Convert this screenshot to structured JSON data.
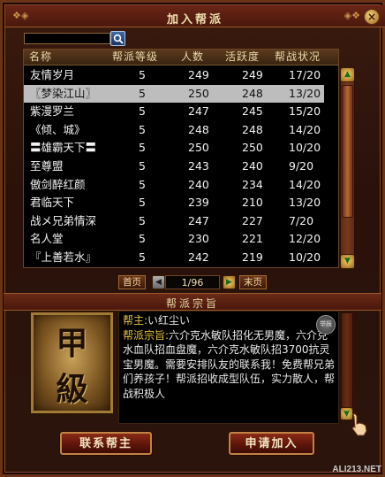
{
  "window": {
    "title": "加入帮派"
  },
  "search": {
    "value": "",
    "button_icon": "search-icon"
  },
  "guild_list": {
    "columns": [
      "名称",
      "帮派等级",
      "人数",
      "活跃度",
      "帮战状况"
    ],
    "selected_index": 1,
    "rows": [
      {
        "name": "友情岁月",
        "level": "5",
        "members": "249",
        "activity": "249",
        "status": "17/20"
      },
      {
        "name": "〖梦染江山〗",
        "level": "5",
        "members": "250",
        "activity": "248",
        "status": "13/20"
      },
      {
        "name": "紫漫罗兰",
        "level": "5",
        "members": "247",
        "activity": "245",
        "status": "15/20"
      },
      {
        "name": "《倾、城》",
        "level": "5",
        "members": "248",
        "activity": "248",
        "status": "14/20"
      },
      {
        "name": "〓雄霸天下〓",
        "level": "5",
        "members": "250",
        "activity": "250",
        "status": "10/20"
      },
      {
        "name": "至尊盟",
        "level": "5",
        "members": "243",
        "activity": "240",
        "status": "9/20"
      },
      {
        "name": "傲剑醉红颜",
        "level": "5",
        "members": "240",
        "activity": "234",
        "status": "14/20"
      },
      {
        "name": "君临天下",
        "level": "5",
        "members": "239",
        "activity": "210",
        "status": "13/20"
      },
      {
        "name": "战メ兄弟情深",
        "level": "5",
        "members": "247",
        "activity": "227",
        "status": "7/20"
      },
      {
        "name": "名人堂",
        "level": "5",
        "members": "230",
        "activity": "221",
        "status": "12/20"
      },
      {
        "name": "『上善若水』",
        "level": "5",
        "members": "242",
        "activity": "219",
        "status": "10/20"
      }
    ]
  },
  "pager": {
    "first_label": "首页",
    "page": "1/96",
    "last_label": "末页"
  },
  "purpose_section": {
    "title": "帮派宗旨",
    "emblem_chars": [
      "甲",
      "級"
    ],
    "leader_label": "帮主:",
    "leader_name": "い红尘い",
    "purpose_label": "帮派宗旨:",
    "purpose_text": "六介克水敏队招化无男魔，六介克水血队招血盘魔，六介克水敏队招3700抗灵宝男魔。需要安排队友的联系我！免费帮兄弟们养孩子！帮派招收成型队伍，实力散人，帮战积极人",
    "seal_text": "举报"
  },
  "buttons": {
    "contact_leader": "联系帮主",
    "apply_join": "申请加入"
  },
  "watermark": "ALI213.NET",
  "colors": {
    "accent_gold": "#e3c23a",
    "selected_row": "#bdbdbd",
    "frame_brown": "#2a120a"
  }
}
